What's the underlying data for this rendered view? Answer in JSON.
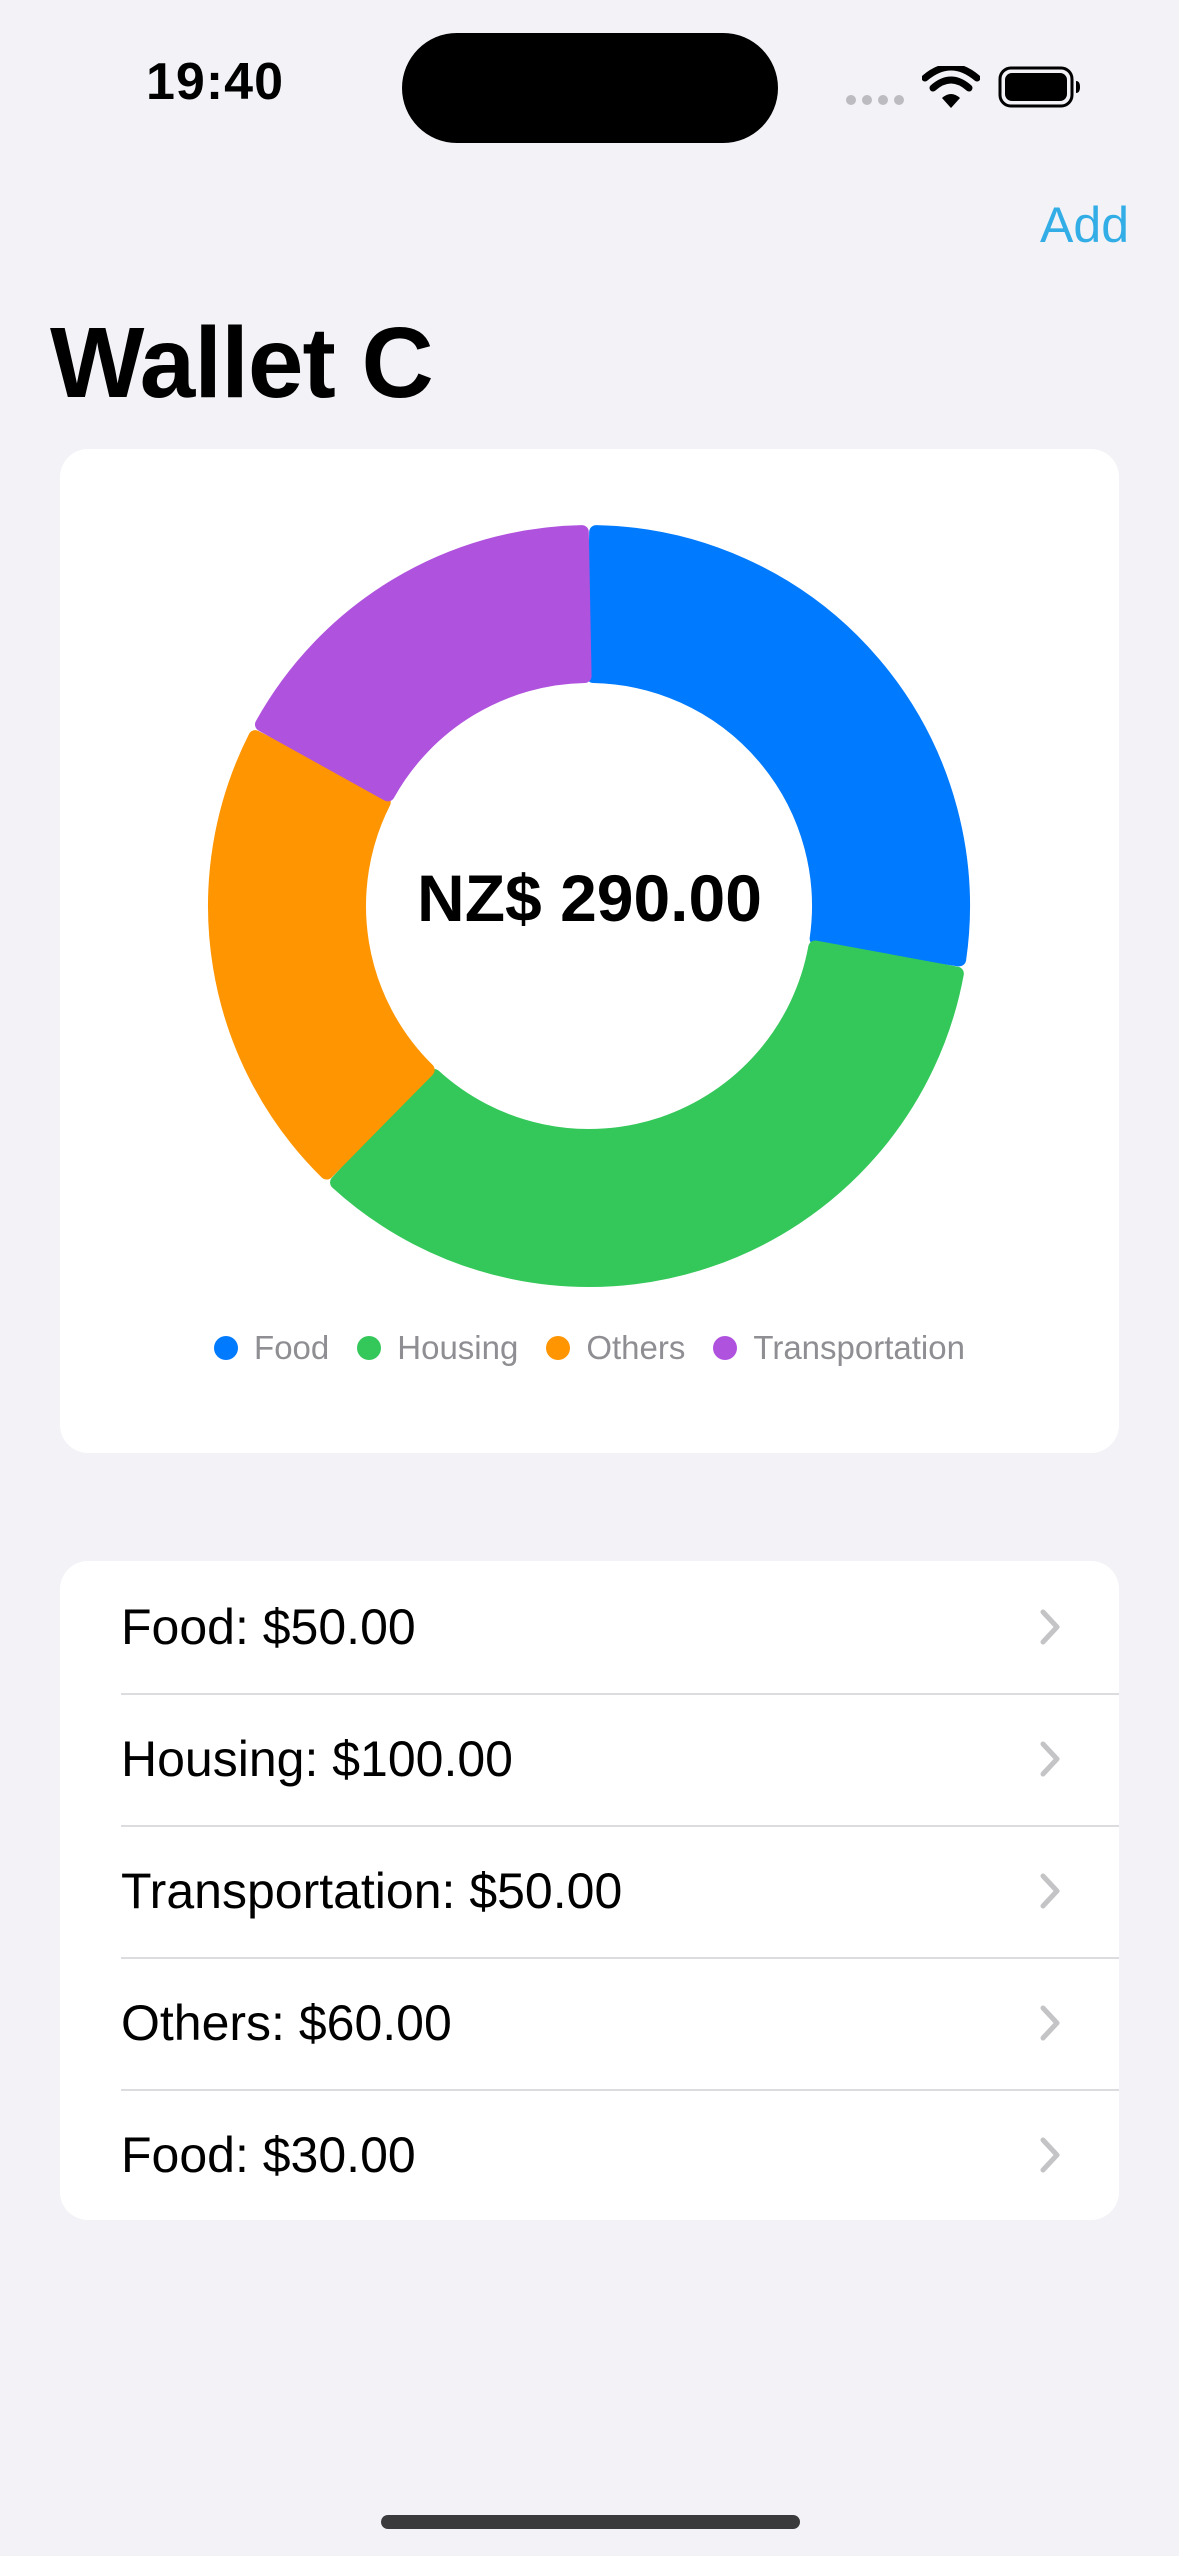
{
  "status_bar": {
    "time": "19:40"
  },
  "nav": {
    "add_label": "Add"
  },
  "page": {
    "title": "Wallet C"
  },
  "chart_data": {
    "type": "pie",
    "center_label": "NZ$ 290.00",
    "categories": [
      "Food",
      "Housing",
      "Others",
      "Transportation"
    ],
    "values": [
      80,
      100,
      60,
      50
    ],
    "colors": [
      "#007aff",
      "#34c759",
      "#ff9500",
      "#af52de"
    ],
    "legend": "bottom"
  },
  "transactions": [
    {
      "label": "Food: $50.00"
    },
    {
      "label": "Housing: $100.00"
    },
    {
      "label": "Transportation: $50.00"
    },
    {
      "label": "Others: $60.00"
    },
    {
      "label": "Food: $30.00"
    }
  ]
}
